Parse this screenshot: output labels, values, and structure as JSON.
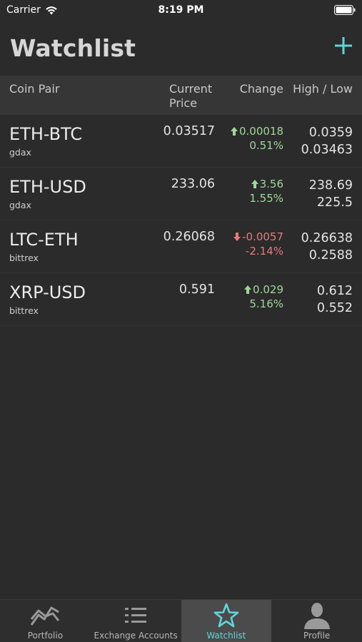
{
  "status_bar": {
    "carrier": "Carrier",
    "time": "8:19 PM"
  },
  "header": {
    "title": "Watchlist",
    "add_icon": "plus-icon"
  },
  "table_header": {
    "coin_pair": "Coin Pair",
    "current_price_line1": "Current",
    "current_price_line2": "Price",
    "change": "Change",
    "high_low": "High / Low"
  },
  "rows": [
    {
      "pair": "ETH-BTC",
      "exchange": "gdax",
      "price": "0.03517",
      "change": "0.00018",
      "change_pct": "0.51%",
      "direction": "up",
      "high": "0.0359",
      "low": "0.03463"
    },
    {
      "pair": "ETH-USD",
      "exchange": "gdax",
      "price": "233.06",
      "change": "3.56",
      "change_pct": "1.55%",
      "direction": "up",
      "high": "238.69",
      "low": "225.5"
    },
    {
      "pair": "LTC-ETH",
      "exchange": "bittrex",
      "price": "0.26068",
      "change": "-0.0057",
      "change_pct": "-2.14%",
      "direction": "down",
      "high": "0.26638",
      "low": "0.2588"
    },
    {
      "pair": "XRP-USD",
      "exchange": "bittrex",
      "price": "0.591",
      "change": "0.029",
      "change_pct": "5.16%",
      "direction": "up",
      "high": "0.612",
      "low": "0.552"
    }
  ],
  "tabs": [
    {
      "label": "Portfolio",
      "icon": "portfolio-chart-icon",
      "active": false
    },
    {
      "label": "Exchange Accounts",
      "icon": "list-icon",
      "active": false
    },
    {
      "label": "Watchlist",
      "icon": "star-icon",
      "active": true
    },
    {
      "label": "Profile",
      "icon": "person-icon",
      "active": false
    }
  ],
  "colors": {
    "background": "#2b2b2b",
    "accent": "#5fd6dc",
    "positive": "#9fd79a",
    "negative": "#e67a7a"
  }
}
